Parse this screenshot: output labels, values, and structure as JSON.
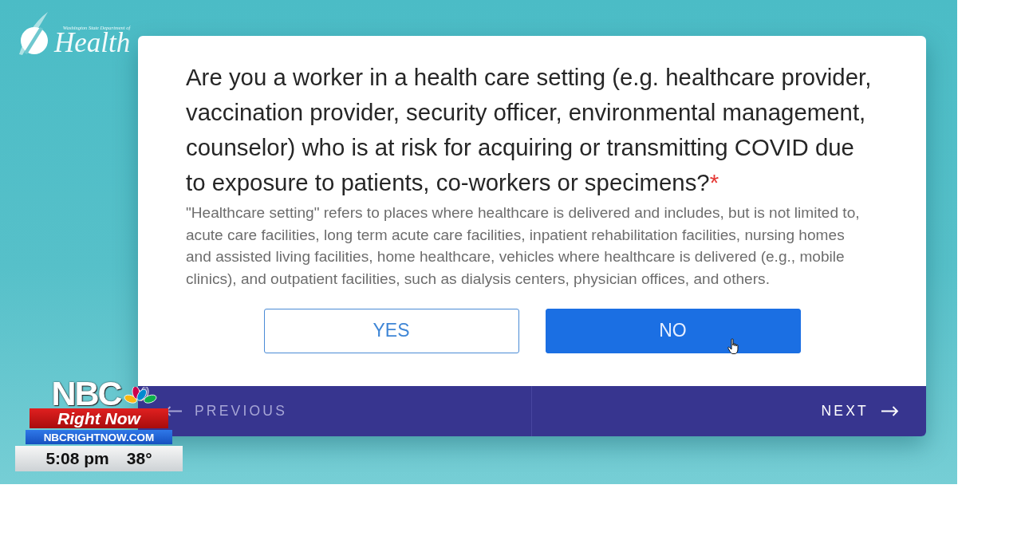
{
  "logo": {
    "subtitle": "Washington State Department of",
    "title": "Health"
  },
  "question": {
    "text": "Are you a worker in a health care setting (e.g. healthcare provider, vaccination provider, security officer, environmental management, counselor) who is at risk for acquiring or transmitting COVID due to exposure to patients, co-workers or specimens?",
    "required_mark": "*"
  },
  "description": "\"Healthcare setting\" refers to places where healthcare is delivered and includes, but is not limited to, acute care facilities, long term acute care facilities, inpatient rehabilitation facilities, nursing homes and assisted living facilities, home healthcare, vehicles where healthcare is delivered (e.g., mobile clinics), and outpatient facilities, such as dialysis centers, physician offices, and others.",
  "options": [
    {
      "label": "YES",
      "selected": false
    },
    {
      "label": "NO",
      "selected": true
    }
  ],
  "navigation": [
    {
      "kind": "previous",
      "label": "PREVIOUS",
      "disabled": true
    },
    {
      "kind": "next",
      "label": "NEXT",
      "disabled": false
    }
  ],
  "broadcast_overlay": {
    "network": "NBC",
    "show": "Right Now",
    "website": "NBCRIGHTNOW.COM",
    "time": "5:08 pm",
    "temperature": "38°"
  }
}
